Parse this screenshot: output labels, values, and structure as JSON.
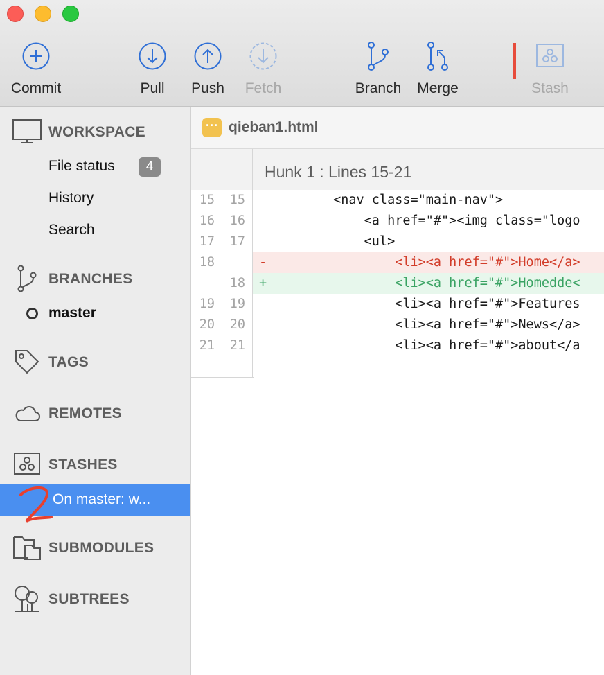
{
  "toolbar": {
    "commit": "Commit",
    "pull": "Pull",
    "push": "Push",
    "fetch": "Fetch",
    "branch": "Branch",
    "merge": "Merge",
    "stash": "Stash",
    "accent_color": "#2f6fd6"
  },
  "sidebar": {
    "workspace": {
      "title": "WORKSPACE",
      "items": [
        "File status",
        "History",
        "Search"
      ],
      "file_status_count": "4"
    },
    "branches": {
      "title": "BRANCHES",
      "current": "master"
    },
    "tags": {
      "title": "TAGS"
    },
    "remotes": {
      "title": "REMOTES"
    },
    "stashes": {
      "title": "STASHES",
      "selected_item": "On master: w..."
    },
    "submodules": {
      "title": "SUBMODULES"
    },
    "subtrees": {
      "title": "SUBTREES"
    }
  },
  "file": {
    "name": "qieban1.html",
    "icon_glyph": "···"
  },
  "hunk": {
    "title": "Hunk 1 : Lines 15-21",
    "lines": [
      {
        "old": "15",
        "new": "15",
        "mark": "",
        "type": "ctx",
        "code": "        <nav class=\"main-nav\">"
      },
      {
        "old": "16",
        "new": "16",
        "mark": "",
        "type": "ctx",
        "code": "            <a href=\"#\"><img class=\"logo"
      },
      {
        "old": "17",
        "new": "17",
        "mark": "",
        "type": "ctx",
        "code": "            <ul>"
      },
      {
        "old": "18",
        "new": "",
        "mark": "-",
        "type": "del",
        "code": "                <li><a href=\"#\">Home</a>"
      },
      {
        "old": "",
        "new": "18",
        "mark": "+",
        "type": "add",
        "code": "                <li><a href=\"#\">Homedde<"
      },
      {
        "old": "19",
        "new": "19",
        "mark": "",
        "type": "ctx",
        "code": "                <li><a href=\"#\">Features"
      },
      {
        "old": "20",
        "new": "20",
        "mark": "",
        "type": "ctx",
        "code": "                <li><a href=\"#\">News</a>"
      },
      {
        "old": "21",
        "new": "21",
        "mark": "",
        "type": "ctx",
        "code": "                <li><a href=\"#\">about</a"
      }
    ]
  }
}
